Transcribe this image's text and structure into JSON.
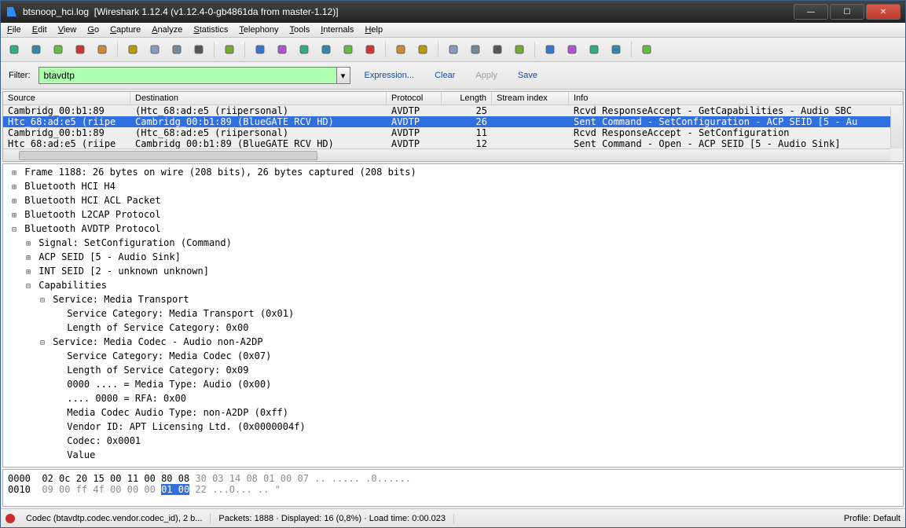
{
  "titlebar": {
    "filename": "btsnoop_hci.log",
    "app": "[Wireshark 1.12.4  (v1.12.4-0-gb4861da from master-1.12)]"
  },
  "menu": [
    "File",
    "Edit",
    "View",
    "Go",
    "Capture",
    "Analyze",
    "Statistics",
    "Telephony",
    "Tools",
    "Internals",
    "Help"
  ],
  "toolbar_icons": [
    "record-circle-icon",
    "record-target-icon",
    "play-green-icon",
    "stop-red-icon",
    "restart-icon",
    "sep",
    "open-icon",
    "save-icon",
    "close-icon",
    "refresh-icon",
    "sep",
    "print-icon",
    "sep",
    "find-icon",
    "back-icon",
    "forward-icon",
    "jump-icon",
    "goto-top-icon",
    "goto-bottom-icon",
    "sep",
    "layout1-icon",
    "layout2-icon",
    "sep",
    "zoom-in-icon",
    "zoom-out-icon",
    "zoom-reset-icon",
    "resize-cols-icon",
    "sep",
    "capture-filter-icon",
    "display-filter-icon",
    "coloring-icon",
    "prefs-icon",
    "sep",
    "help-icon"
  ],
  "filter": {
    "label": "Filter:",
    "value": "btavdtp",
    "btn_expression": "Expression...",
    "btn_clear": "Clear",
    "btn_apply": "Apply",
    "btn_save": "Save"
  },
  "columns": [
    "Source",
    "Destination",
    "Protocol",
    "Length",
    "Stream index",
    "Info"
  ],
  "packets": [
    {
      "src": "Cambridg_00:b1:89",
      "dst": "(Htc_68:ad:e5 (riipersonal)",
      "proto": "AVDTP",
      "len": "25",
      "si": "",
      "info": "Rcvd ResponseAccept - GetCapabilities - Audio SBC",
      "sel": false
    },
    {
      "src": "Htc_68:ad:e5 (riipe",
      "dst": "Cambridg_00:b1:89 (BlueGATE RCV HD)",
      "proto": "AVDTP",
      "len": "26",
      "si": "",
      "info": "Sent Command - SetConfiguration - ACP SEID [5 - Au",
      "sel": true
    },
    {
      "src": "Cambridg_00:b1:89",
      "dst": "(Htc_68:ad:e5 (riipersonal)",
      "proto": "AVDTP",
      "len": "11",
      "si": "",
      "info": "Rcvd ResponseAccept - SetConfiguration",
      "sel": false
    },
    {
      "src": "Htc_68:ad:e5 (riipe",
      "dst": "Cambridg_00:b1:89 (BlueGATE RCV HD)",
      "proto": "AVDTP",
      "len": "12",
      "si": "",
      "info": "Sent Command - Open - ACP SEID [5 - Audio Sink]",
      "sel": false
    }
  ],
  "detail": [
    {
      "ind": 0,
      "t": "+",
      "txt": "Frame 1188: 26 bytes on wire (208 bits), 26 bytes captured (208 bits)"
    },
    {
      "ind": 0,
      "t": "+",
      "txt": "Bluetooth HCI H4"
    },
    {
      "ind": 0,
      "t": "+",
      "txt": "Bluetooth HCI ACL Packet"
    },
    {
      "ind": 0,
      "t": "+",
      "txt": "Bluetooth L2CAP Protocol"
    },
    {
      "ind": 0,
      "t": "-",
      "txt": "Bluetooth AVDTP Protocol"
    },
    {
      "ind": 1,
      "t": "+",
      "txt": "Signal: SetConfiguration (Command)"
    },
    {
      "ind": 1,
      "t": "+",
      "txt": "ACP SEID [5 - Audio Sink]"
    },
    {
      "ind": 1,
      "t": "+",
      "txt": "INT SEID [2 - unknown unknown]"
    },
    {
      "ind": 1,
      "t": "-",
      "txt": "Capabilities"
    },
    {
      "ind": 2,
      "t": "-",
      "txt": "Service: Media Transport"
    },
    {
      "ind": 3,
      "t": " ",
      "txt": "Service Category: Media Transport (0x01)"
    },
    {
      "ind": 3,
      "t": " ",
      "txt": "Length of Service Category: 0x00"
    },
    {
      "ind": 2,
      "t": "-",
      "txt": "Service: Media Codec - Audio non-A2DP"
    },
    {
      "ind": 3,
      "t": " ",
      "txt": "Service Category: Media Codec (0x07)"
    },
    {
      "ind": 3,
      "t": " ",
      "txt": "Length of Service Category: 0x09"
    },
    {
      "ind": 3,
      "t": " ",
      "txt": "0000 .... = Media Type: Audio (0x00)"
    },
    {
      "ind": 3,
      "t": " ",
      "txt": ".... 0000 = RFA: 0x00"
    },
    {
      "ind": 3,
      "t": " ",
      "txt": "Media Codec Audio Type: non-A2DP (0xff)"
    },
    {
      "ind": 3,
      "t": " ",
      "txt": "Vendor ID: APT Licensing Ltd. (0x0000004f)"
    },
    {
      "ind": 3,
      "t": " ",
      "txt": "Codec: 0x0001"
    },
    {
      "ind": 3,
      "t": " ",
      "txt": "Value"
    }
  ],
  "hex": {
    "line0_off": "0000",
    "line0_a": "02 0c 20 15 00 11 00 80  08 ",
    "line0_b": "30 03 14 08 01 00 07",
    "line0_ascii": "   .. .....  .0......",
    "line1_off": "0010",
    "line1_a": "09 00 ff 4f 00 00 00 ",
    "line1_sel": "01  00",
    "line1_c": " 22",
    "line1_ascii": "   ...O... .. \""
  },
  "status": {
    "left": "Codec (btavdtp.codec.vendor.codec_id), 2 b...",
    "mid": "Packets: 1888 · Displayed: 16 (0,8%) · Load time: 0:00.023",
    "right": "Profile: Default"
  }
}
